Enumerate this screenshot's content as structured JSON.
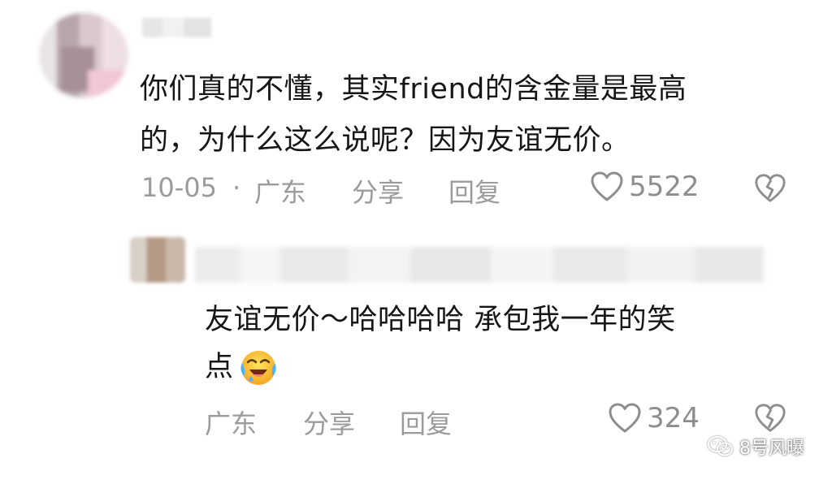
{
  "comments": [
    {
      "text_lines": [
        "你们真的不懂，其实friend的含金量是最高",
        "的，为什么这么说呢？因为友谊无价。"
      ],
      "date": "10-05",
      "separator": "·",
      "region": "广东",
      "share_label": "分享",
      "reply_label": "回复",
      "likes": "5522"
    },
    {
      "text_lines": [
        "友谊无价～哈哈哈哈 承包我一年的笑",
        "点"
      ],
      "emoji": "crying-laughing-emoji",
      "region": "广东",
      "share_label": "分享",
      "reply_label": "回复",
      "likes": "324"
    }
  ],
  "watermark": {
    "icon": "wechat-icon",
    "text": "8号风曝"
  },
  "colors": {
    "text": "#161616",
    "meta": "#9b9b9b",
    "background": "#ffffff"
  }
}
